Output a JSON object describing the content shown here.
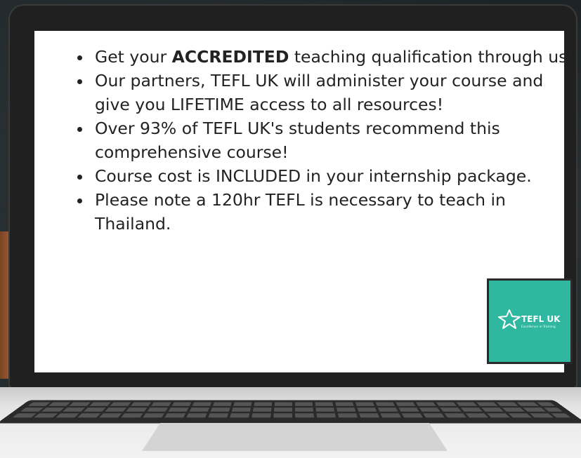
{
  "bullets": [
    {
      "pre": "Get your ",
      "bold": "ACCREDITED",
      "post": " teaching qualification through us!"
    },
    {
      "pre": "Our partners, TEFL UK will administer your course and give you LIFETIME access to all resources!",
      "bold": "",
      "post": ""
    },
    {
      "pre": "Over 93% of TEFL UK's students recommend this comprehensive course!",
      "bold": "",
      "post": ""
    },
    {
      "pre": "Course cost is INCLUDED in your internship package.",
      "bold": "",
      "post": ""
    },
    {
      "pre": "Please note a 120hr TEFL is necessary to teach in Thailand.",
      "bold": "",
      "post": ""
    }
  ],
  "logo": {
    "title": "TEFL UK",
    "tagline": "Excellence in Training",
    "bg_color": "#2fb7a0",
    "icon": "star-outline-icon"
  }
}
